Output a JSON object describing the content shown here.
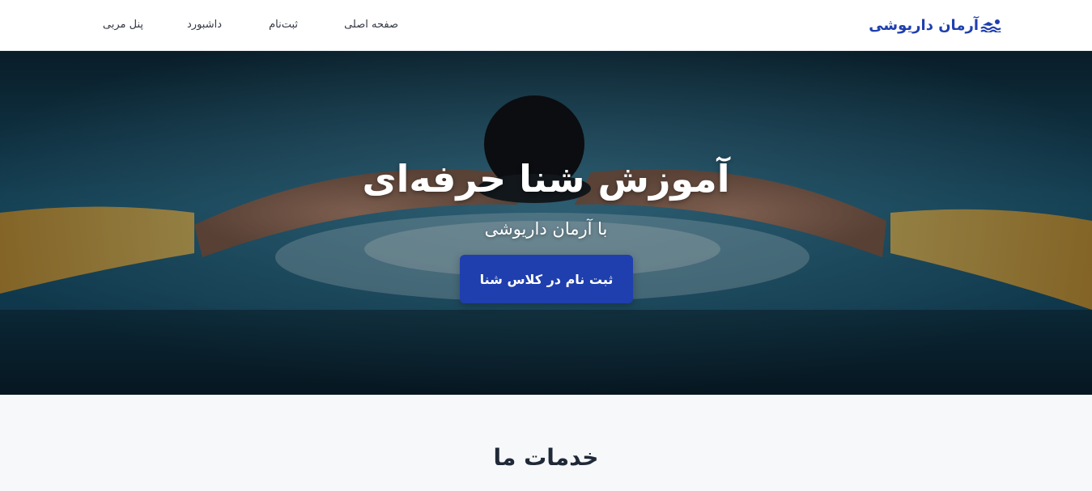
{
  "navbar": {
    "brand": "آرمان داریوشی",
    "brand_icon": "swimmer-icon",
    "links": {
      "home": "صفحه اصلی",
      "register": "ثبت‌نام",
      "dashboard": "داشبورد",
      "coach_panel": "پنل مربی"
    }
  },
  "hero": {
    "title": "آموزش شنا حرفه‌ای",
    "subtitle": "با آرمان داریوشی",
    "cta_label": "ثبت نام در کلاس شنا"
  },
  "services": {
    "title": "خدمات ما"
  },
  "colors": {
    "brand": "#1f3fae",
    "nav_text": "#333842",
    "section_bg": "#f7f8fa",
    "heading": "#1f2937"
  }
}
